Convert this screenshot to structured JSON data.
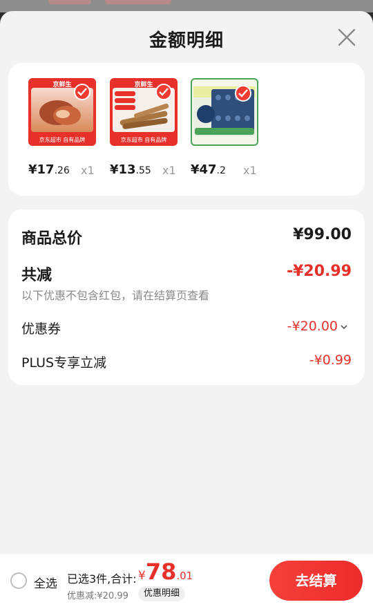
{
  "sheet": {
    "title": "金额明细"
  },
  "products": [
    {
      "brand": "京鲜生",
      "price_int": "¥17",
      "price_dec": ".26",
      "qty": "x1",
      "footer": "京东超市 自有品牌"
    },
    {
      "brand": "京鲜生",
      "price_int": "¥13",
      "price_dec": ".55",
      "qty": "x1",
      "footer": "京东超市 自有品牌"
    },
    {
      "brand": "",
      "price_int": "¥47",
      "price_dec": ".2",
      "qty": "x1",
      "footer": ""
    }
  ],
  "summary": {
    "total_label": "商品总价",
    "total_value": "¥99.00",
    "reduce_label": "共减",
    "reduce_value": "-¥20.99",
    "reduce_note": "以下优惠不包含红包，请在结算页查看",
    "coupon_label": "优惠券",
    "coupon_value": "-¥20.00",
    "plus_label": "PLUS专享立减",
    "plus_value": "-¥0.99"
  },
  "bottom": {
    "select_all": "全选",
    "selected_info": "已选3件,合计:",
    "total_yen": "¥",
    "total_int": "78",
    "total_dec": ".01",
    "discount": "优惠减:¥20.99",
    "detail_label": "优惠明细",
    "checkout_label": "去结算"
  },
  "colors": {
    "accent": "#e8302b",
    "background": "#f3f3f3"
  }
}
